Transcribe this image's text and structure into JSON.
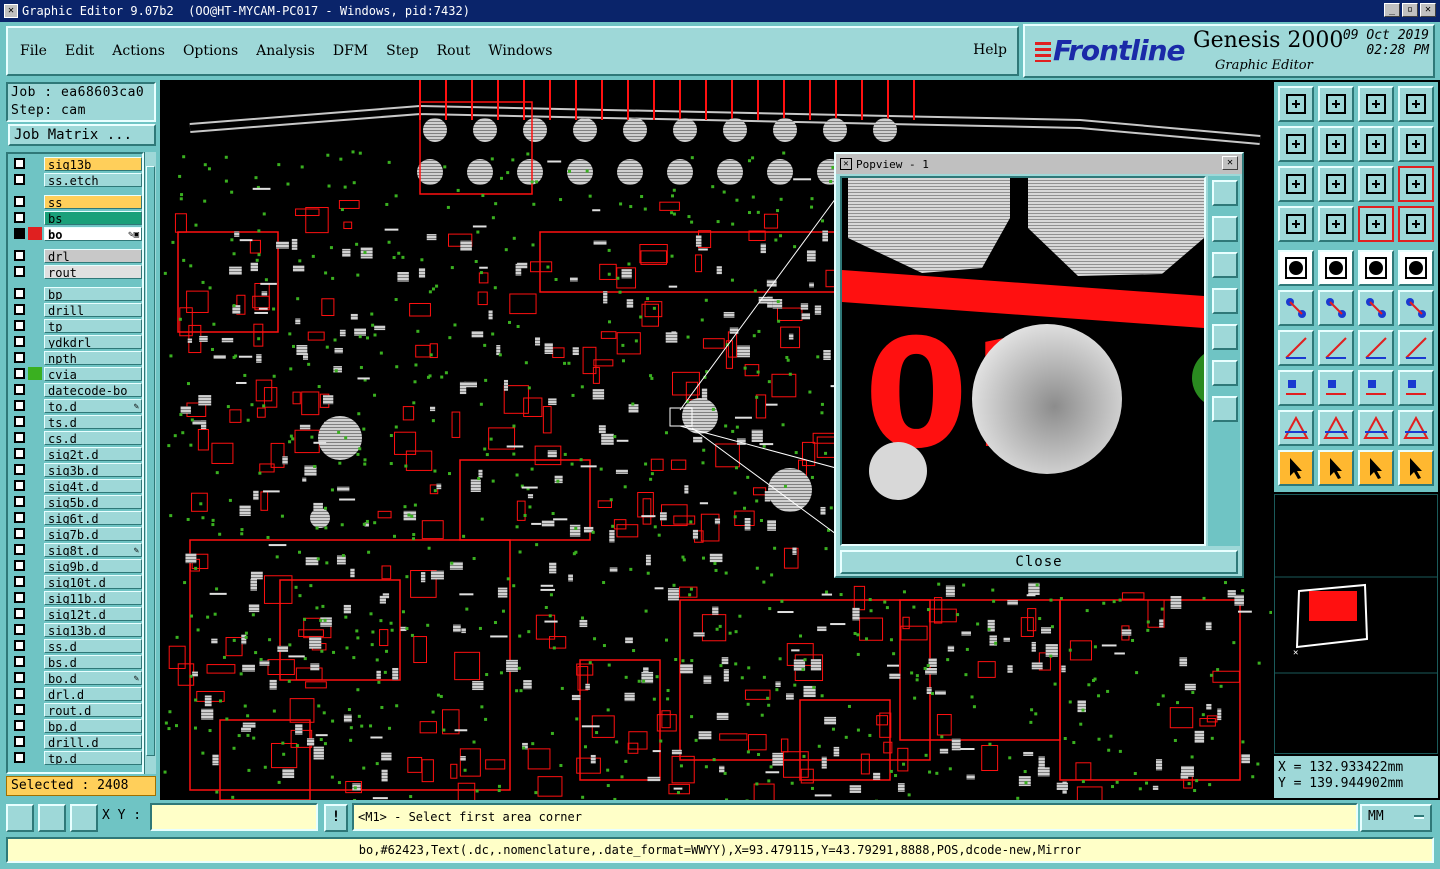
{
  "window": {
    "title": "Graphic Editor 9.07b2  (OO@HT-MYCAM-PC017 - Windows, pid:7432)",
    "btn_min": "_",
    "btn_max": "▫",
    "btn_close": "✕"
  },
  "menu": {
    "items": [
      "File",
      "Edit",
      "Actions",
      "Options",
      "Analysis",
      "DFM",
      "Step",
      "Rout",
      "Windows"
    ],
    "help": "Help"
  },
  "brand": {
    "logo": "Frontline",
    "product": "Genesis 2000",
    "subtitle": "Graphic Editor",
    "date": "09 Oct 2019",
    "time": "02:28 PM",
    "colors": {
      "logo_blue": "#1a2aa8",
      "logo_red": "#e02020"
    }
  },
  "job": {
    "job_line": "Job : ea68603ca0",
    "step_line": "Step: cam",
    "matrix_button": "Job Matrix ..."
  },
  "layers": [
    {
      "name": "sig13b",
      "color": "#ffcf5a",
      "group": 0
    },
    {
      "name": "ss.etch",
      "color": "#9ed8d8",
      "group": 0
    },
    {
      "name": "ss",
      "color": "#ffcf5a",
      "group": 1
    },
    {
      "name": "bs",
      "color": "#1aa07a",
      "group": 1
    },
    {
      "name": "bo",
      "color": "#ffffff",
      "group": 1,
      "work": true,
      "flag": "✎▣"
    },
    {
      "name": "drl",
      "color": "#c8c8c8",
      "group": 2
    },
    {
      "name": "rout",
      "color": "#e0e0e0",
      "group": 2
    },
    {
      "name": "bp",
      "color": "#9ed8d8",
      "group": 3
    },
    {
      "name": "drill",
      "color": "#9ed8d8",
      "group": 3
    },
    {
      "name": "tp",
      "color": "#9ed8d8",
      "group": 3
    },
    {
      "name": "ydkdrl",
      "color": "#9ed8d8",
      "group": 3
    },
    {
      "name": "npth",
      "color": "#9ed8d8",
      "group": 3
    },
    {
      "name": "cvia",
      "color": "#9ed8d8",
      "group": 3,
      "green": true
    },
    {
      "name": "datecode-bo",
      "color": "#9ed8d8",
      "group": 3
    },
    {
      "name": "to.d",
      "color": "#9ed8d8",
      "group": 3,
      "flag": "✎"
    },
    {
      "name": "ts.d",
      "color": "#9ed8d8",
      "group": 3
    },
    {
      "name": "cs.d",
      "color": "#9ed8d8",
      "group": 3
    },
    {
      "name": "sig2t.d",
      "color": "#9ed8d8",
      "group": 3
    },
    {
      "name": "sig3b.d",
      "color": "#9ed8d8",
      "group": 3
    },
    {
      "name": "sig4t.d",
      "color": "#9ed8d8",
      "group": 3
    },
    {
      "name": "sig5b.d",
      "color": "#9ed8d8",
      "group": 3
    },
    {
      "name": "sig6t.d",
      "color": "#9ed8d8",
      "group": 3
    },
    {
      "name": "sig7b.d",
      "color": "#9ed8d8",
      "group": 3
    },
    {
      "name": "sig8t.d",
      "color": "#9ed8d8",
      "group": 3,
      "flag": "✎"
    },
    {
      "name": "sig9b.d",
      "color": "#9ed8d8",
      "group": 3
    },
    {
      "name": "sig10t.d",
      "color": "#9ed8d8",
      "group": 3
    },
    {
      "name": "sig11b.d",
      "color": "#9ed8d8",
      "group": 3
    },
    {
      "name": "sig12t.d",
      "color": "#9ed8d8",
      "group": 3
    },
    {
      "name": "sig13b.d",
      "color": "#9ed8d8",
      "group": 3
    },
    {
      "name": "ss.d",
      "color": "#9ed8d8",
      "group": 3
    },
    {
      "name": "bs.d",
      "color": "#9ed8d8",
      "group": 3
    },
    {
      "name": "bo.d",
      "color": "#9ed8d8",
      "group": 3,
      "flag": "✎"
    },
    {
      "name": "drl.d",
      "color": "#9ed8d8",
      "group": 3
    },
    {
      "name": "rout.d",
      "color": "#9ed8d8",
      "group": 3
    },
    {
      "name": "bp.d",
      "color": "#9ed8d8",
      "group": 3
    },
    {
      "name": "drill.d",
      "color": "#9ed8d8",
      "group": 3
    },
    {
      "name": "tp.d",
      "color": "#9ed8d8",
      "group": 3
    }
  ],
  "selected": "Selected : 2408",
  "popview": {
    "title": "Popview - 1",
    "close_label": "Close",
    "text_glyph": "01"
  },
  "coords": {
    "x_line": "X = 132.933422mm",
    "y_line": "Y = 139.944902mm"
  },
  "bottom": {
    "xy_label": "X Y :",
    "xy_value": "",
    "excl_label": "!",
    "prompt": "<M1> - Select first area corner",
    "units": "MM",
    "status": "bo,#62423,Text(.dc,.nomenclature,.date_format=WWYY),X=93.479115,Y=43.79291,8888,POS,dcode-new,Mirror"
  },
  "tools": [
    "home-icon",
    "zoom-home-icon",
    "zoom-fit-profile-icon",
    "zoom-window-icon",
    "zoom-prev-icon",
    "zoom-next-icon",
    "zoom-out-icon",
    "snap-icon",
    "pan-icon",
    "center-icon",
    "ratio-1-2-icon",
    "help-query-icon",
    "measure-icon",
    "key-icon",
    "layer-toggle-icon",
    "layer-compare-icon",
    "feature-select-icon",
    "area-select-icon",
    "ruler-icon",
    "pad-icon",
    "net-icon",
    "cross-icon",
    "line-add-icon",
    "line-to-pad-icon",
    "angle-icon",
    "slash-icon",
    "arc-icon",
    "split-icon",
    "move-icon",
    "minus-icon",
    "center-mark-icon",
    "group-icon",
    "triangle-a-icon",
    "triangle-b-icon",
    "triangle-c-icon",
    "triangle-d-icon",
    "pointer-icon",
    "pointer-box-icon",
    "pointer-circle-icon",
    "pointer-net-icon"
  ]
}
